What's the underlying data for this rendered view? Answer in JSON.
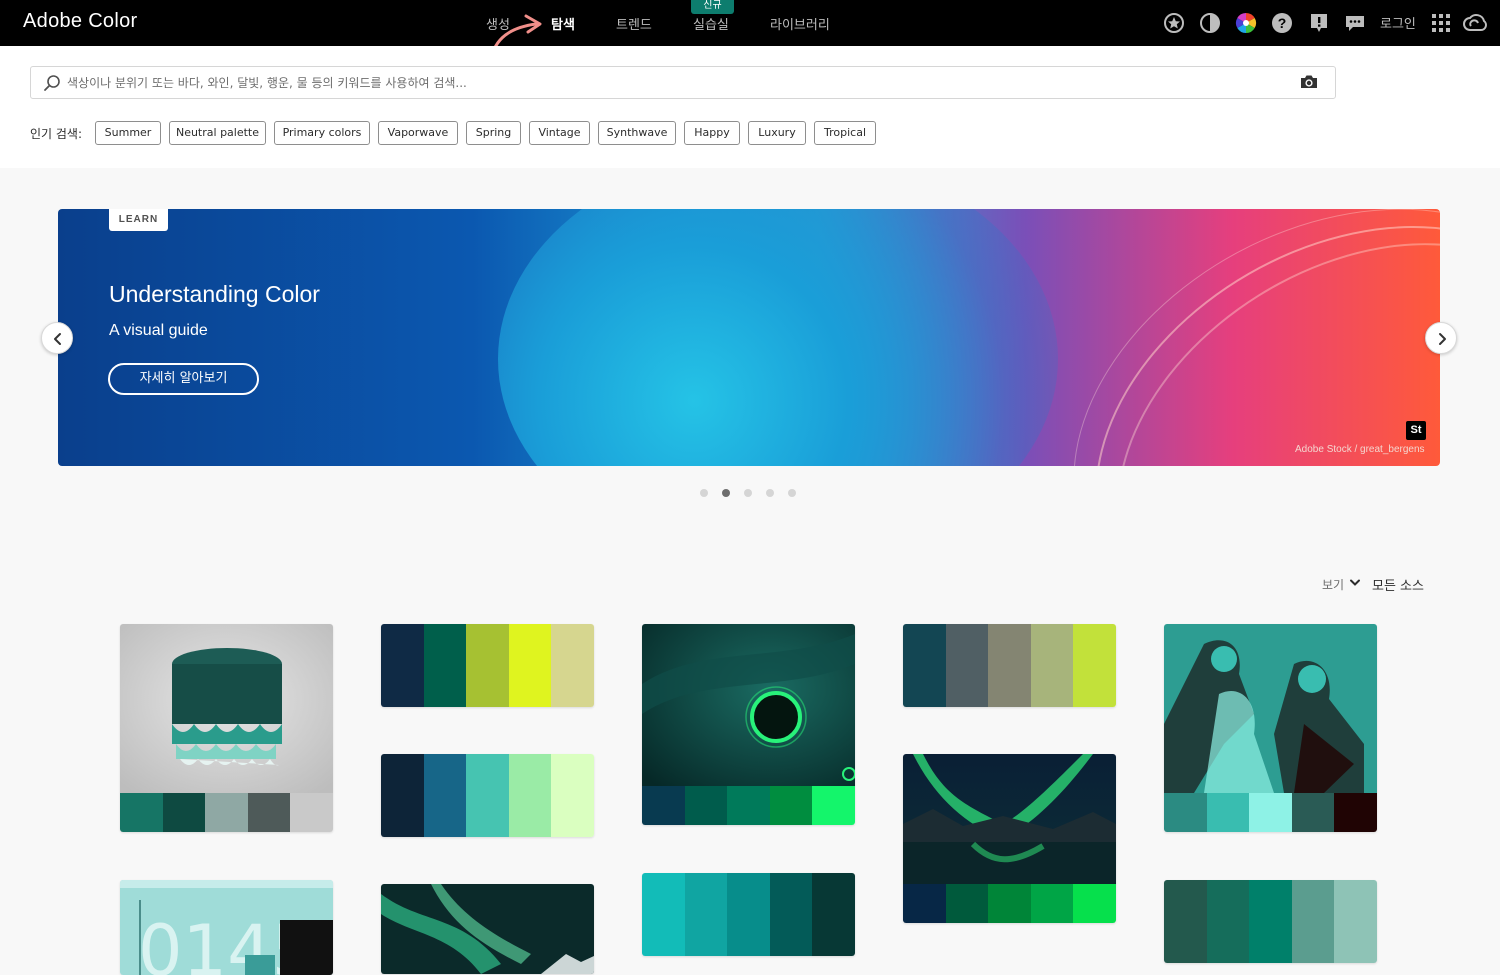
{
  "app": {
    "title": "Adobe Color"
  },
  "nav": {
    "items": [
      {
        "label": "생성",
        "active": false
      },
      {
        "label": "탐색",
        "active": true
      },
      {
        "label": "트렌드",
        "active": false
      },
      {
        "label": "실습실",
        "active": false
      },
      {
        "label": "라이브러리",
        "active": false
      }
    ],
    "new_badge": "신규",
    "login": "로그인",
    "icons": [
      "star-badge-icon",
      "contrast-icon",
      "color-wheel-icon",
      "help-icon",
      "alert-icon",
      "chat-icon",
      "apps-grid-icon",
      "creative-cloud-icon"
    ]
  },
  "search": {
    "placeholder": "색상이나 분위기 또는 바다, 와인, 달빛, 행운, 물 등의 키워드를 사용하여 검색..."
  },
  "popular": {
    "label": "인기 검색:",
    "tags": [
      "Summer",
      "Neutral palette",
      "Primary colors",
      "Vaporwave",
      "Spring",
      "Vintage",
      "Synthwave",
      "Happy",
      "Luxury",
      "Tropical"
    ]
  },
  "banner": {
    "tag": "LEARN",
    "title": "Understanding Color",
    "subtitle": "A visual guide",
    "button": "자세히 알아보기",
    "stock_badge": "St",
    "credit": "Adobe Stock /  great_bergens",
    "dots_total": 5,
    "active_dot": 1
  },
  "view": {
    "label": "보기",
    "source": "모든 소스"
  },
  "cards": [
    {
      "kind": "image",
      "image": "teal-stool",
      "swatches": [
        "#167565",
        "#0e4a41",
        "#8fa8a4",
        "#4e5a59",
        "#c9c9c9"
      ]
    },
    {
      "kind": "palette",
      "swatches": [
        "#0f2a45",
        "#005f4b",
        "#a6c132",
        "#dff41f",
        "#d6d68f"
      ]
    },
    {
      "kind": "palette",
      "swatches": [
        "#0d2438",
        "#176688",
        "#46c4b1",
        "#9aeba6",
        "#daffc0"
      ]
    },
    {
      "kind": "image",
      "image": "green-planet-space",
      "swatches": [
        "#083a50",
        "#005c4c",
        "#007a5a",
        "#008d3f",
        "#14f56b"
      ]
    },
    {
      "kind": "palette",
      "swatches": [
        "#134653",
        "#505f64",
        "#848572",
        "#a7b47b",
        "#c2e13a"
      ]
    },
    {
      "kind": "image",
      "image": "aurora-lake",
      "swatches": [
        "#072746",
        "#005a3c",
        "#008538",
        "#00a546",
        "#06e04c"
      ]
    },
    {
      "kind": "image",
      "image": "teal-illustration",
      "swatches": [
        "#2b8b82",
        "#39bdb0",
        "#8ef2e6",
        "#2a5b55",
        "#200404"
      ]
    },
    {
      "kind": "image",
      "image": "light-teal-building",
      "swatches": []
    },
    {
      "kind": "image",
      "image": "aurora-mountains",
      "swatches": []
    },
    {
      "kind": "palette",
      "swatches": [
        "#12bcb8",
        "#10a5a2",
        "#078d8b",
        "#035b58",
        "#073835"
      ]
    },
    {
      "kind": "palette",
      "swatches": [
        "#23594d",
        "#156d5b",
        "#00806a",
        "#5b9d8f",
        "#8ec3b6"
      ]
    }
  ]
}
